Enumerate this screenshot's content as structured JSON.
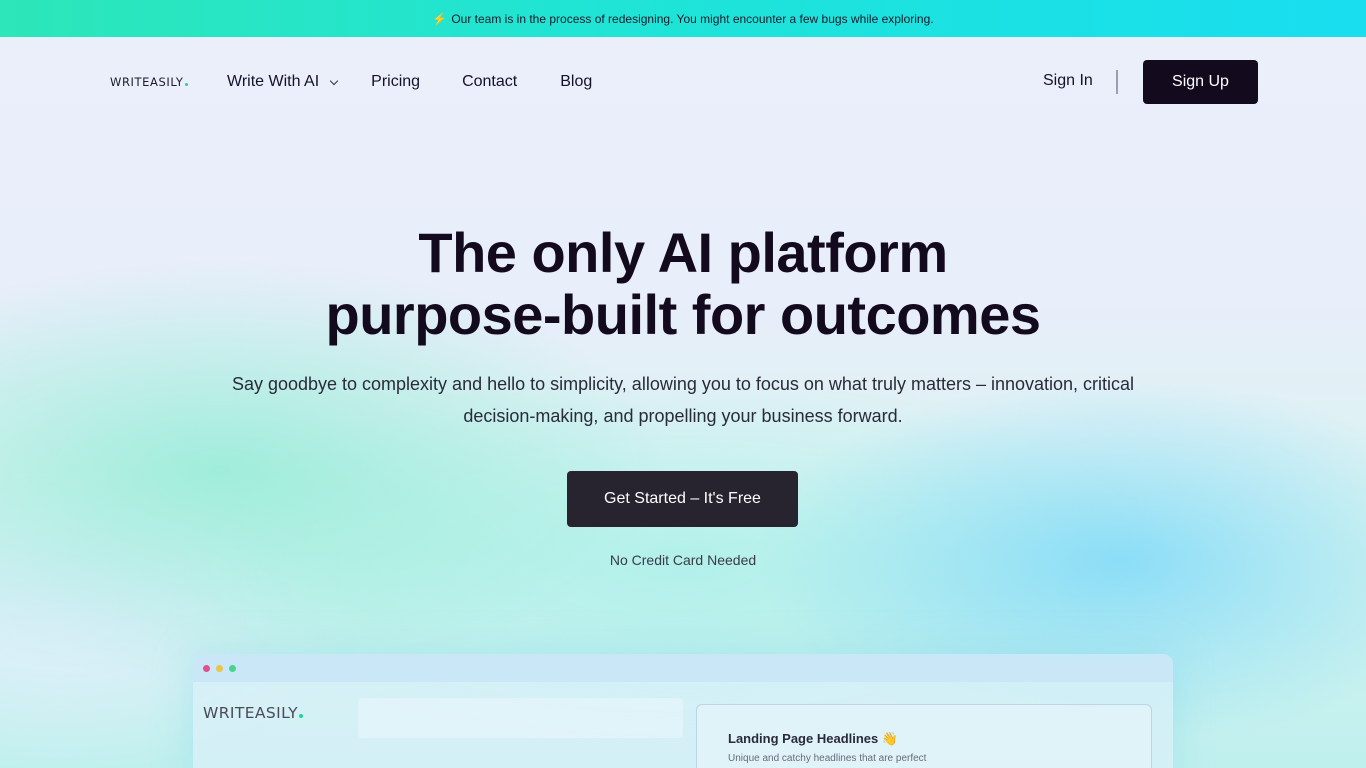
{
  "announcement": {
    "icon": "lightning-icon",
    "text": "Our team is in the process of redesigning. You might encounter a few bugs while exploring."
  },
  "nav": {
    "logo": "WRITEASILY",
    "links": [
      "Write With AI",
      "Pricing",
      "Contact",
      "Blog"
    ],
    "sign_in": "Sign In",
    "sign_up": "Sign Up"
  },
  "hero": {
    "title_line1": "The only AI platform",
    "title_line2": "purpose-built for outcomes",
    "subtitle": "Say goodbye to complexity and hello to simplicity, allowing you to focus on what truly matters – innovation, critical decision-making, and propelling your business forward.",
    "cta": "Get Started – It's Free",
    "note": "No Credit Card Needed"
  },
  "preview": {
    "logo": "WRITEASILY",
    "card_title": "Landing Page Headlines 👋",
    "card_subtitle": "Unique and catchy headlines that are perfect"
  },
  "colors": {
    "brand_dark": "#140a1e",
    "cta_bg": "#27232f",
    "accent_green": "#22d39a",
    "announce_start": "#2de6b9",
    "announce_end": "#18def0"
  }
}
